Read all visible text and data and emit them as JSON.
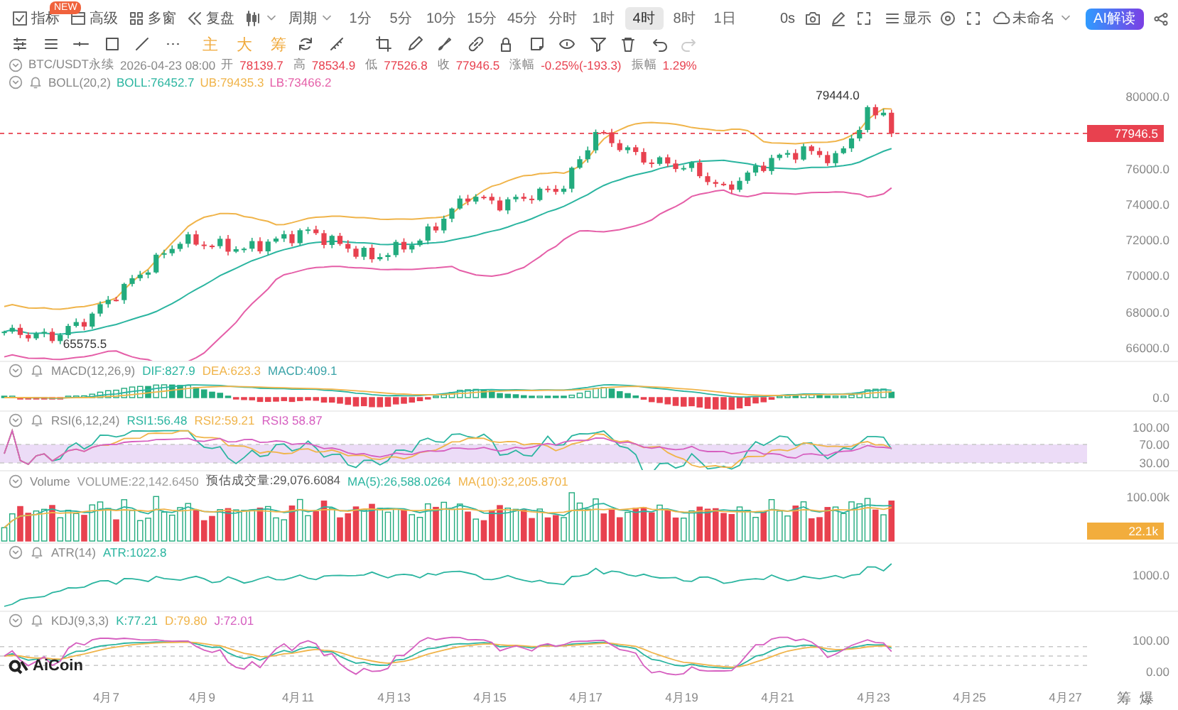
{
  "toolbar": {
    "tools": [
      {
        "label": "指标"
      },
      {
        "label": "高级",
        "badge": "NEW"
      },
      {
        "label": "多窗"
      },
      {
        "label": "复盘"
      }
    ],
    "period_label": "周期",
    "periods": [
      {
        "label": "1分",
        "selected": false
      },
      {
        "label": "5分",
        "selected": false
      },
      {
        "label": "10分",
        "selected": false
      },
      {
        "label": "15分",
        "selected": false
      },
      {
        "label": "45分",
        "selected": false
      },
      {
        "label": "分时",
        "selected": false
      },
      {
        "label": "1时",
        "selected": false
      },
      {
        "label": "4时",
        "selected": true
      },
      {
        "label": "8时",
        "selected": false
      },
      {
        "label": "1日",
        "selected": false
      }
    ],
    "refresh": "0s",
    "display": "显示",
    "layout_name": "未命名",
    "ai_button": "AI解读"
  },
  "drawing_toolbar": {
    "marks": [
      "主",
      "大",
      "筹"
    ]
  },
  "quote": {
    "symbol": "BTC/USDT永续",
    "time": "2026-04-23 08:00",
    "fields": [
      {
        "label": "开",
        "value": "78139.7"
      },
      {
        "label": "高",
        "value": "78534.9"
      },
      {
        "label": "低",
        "value": "77526.8"
      },
      {
        "label": "收",
        "value": "77946.5"
      },
      {
        "label": "涨幅",
        "value": "-0.25%(-193.3)"
      },
      {
        "label": "振幅",
        "value": "1.29%"
      }
    ]
  },
  "boll": {
    "name": "BOLL(20,2)",
    "values": [
      {
        "text": "BOLL:76452.7",
        "color": "#2bb5a0"
      },
      {
        "text": "UB:79435.3",
        "color": "#f0b44a"
      },
      {
        "text": "LB:73466.2",
        "color": "#e55fa8"
      }
    ]
  },
  "main_chart": {
    "high_label": "79444.0",
    "low_label": "65575.5",
    "last_price": "77946.5",
    "y_ticks": [
      "80000.0",
      "76000.0",
      "74000.0",
      "72000.0",
      "70000.0",
      "68000.0",
      "66000.0"
    ]
  },
  "indicators": [
    {
      "kind": "macd",
      "name": "MACD(12,26,9)",
      "values": [
        {
          "text": "DIF:827.9",
          "color": "#2bb5a0"
        },
        {
          "text": "DEA:623.3",
          "color": "#f0b44a"
        },
        {
          "text": "MACD:409.1",
          "color": "#3aa3a8"
        }
      ],
      "axis": [
        "0.0"
      ]
    },
    {
      "kind": "rsi",
      "name": "RSI(6,12,24)",
      "values": [
        {
          "text": "RSI1:56.48",
          "color": "#2bb5a0"
        },
        {
          "text": "RSI2:59.21",
          "color": "#f0b44a"
        },
        {
          "text": "RSI3 58.87",
          "color": "#d65fc0"
        }
      ],
      "axis": [
        "100.00",
        "70.00",
        "30.00"
      ]
    },
    {
      "kind": "volume",
      "name": "Volume",
      "values": [
        {
          "text": "VOLUME:22,142.6450",
          "color": "#9a9a9a"
        },
        {
          "text": "预估成交量:29,076.6084",
          "color": "#555555"
        },
        {
          "text": "MA(5):26,588.0264",
          "color": "#2bb5a0"
        },
        {
          "text": "MA(10):32,205.8701",
          "color": "#f0b44a"
        }
      ],
      "axis": [
        "100.00k"
      ],
      "last_badge": "22.1k"
    },
    {
      "kind": "atr",
      "name": "ATR(14)",
      "values": [
        {
          "text": "ATR:1022.8",
          "color": "#2bb5a0"
        }
      ],
      "axis": [
        "1000.0"
      ]
    },
    {
      "kind": "kdj",
      "name": "KDJ(9,3,3)",
      "values": [
        {
          "text": "K:77.21",
          "color": "#2bb5a0"
        },
        {
          "text": "D:79.80",
          "color": "#f0b44a"
        },
        {
          "text": "J:72.01",
          "color": "#d65fc0"
        }
      ],
      "axis": [
        "100.00",
        "0.00"
      ]
    }
  ],
  "logo": "AiCoin",
  "x_axis": [
    "4月7",
    "4月9",
    "4月11",
    "4月13",
    "4月15",
    "4月17",
    "4月19",
    "4月21",
    "4月23",
    "4月25",
    "4月27"
  ],
  "footer_tools": [
    "筹",
    "爆"
  ]
}
